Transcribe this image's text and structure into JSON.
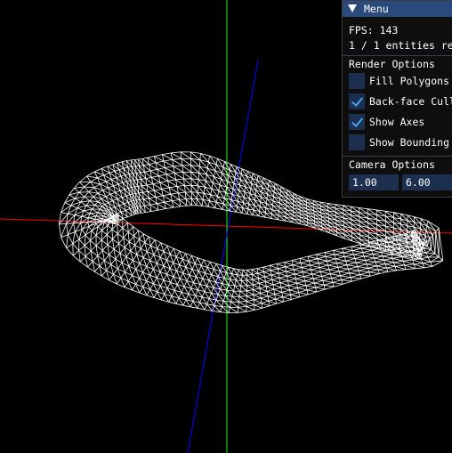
{
  "menu": {
    "title": "Menu",
    "fps_label": "FPS: 143",
    "entities_label": "1 / 1 entities re",
    "render_options": {
      "header": "Render Options",
      "items": [
        {
          "label": "Fill Polygons",
          "checked": false
        },
        {
          "label": "Back-face Cull",
          "checked": true
        },
        {
          "label": "Show Axes",
          "checked": true
        },
        {
          "label": "Show Bounding",
          "checked": false
        }
      ]
    },
    "camera_options": {
      "header": "Camera Options",
      "values": [
        "1.00",
        "6.00",
        ""
      ]
    }
  },
  "scene": {
    "axis_colors": {
      "x": "#ff0000",
      "y": "#00ff00",
      "z": "#0000ff"
    },
    "mesh_color": "#ffffff",
    "background": "#000000"
  }
}
